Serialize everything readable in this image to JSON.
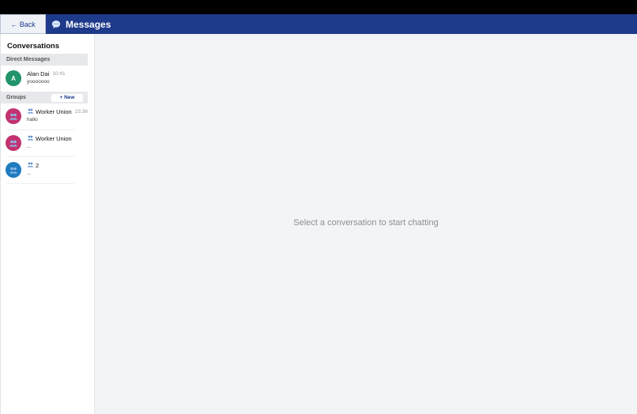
{
  "header": {
    "back_label": "← Back",
    "title": "Messages",
    "icon": "chat-bubble-icon",
    "bg_color": "#1e3a8a"
  },
  "sidebar": {
    "title": "Conversations",
    "direct_messages": {
      "heading": "Direct Messages",
      "items": [
        {
          "avatar_letter": "A",
          "avatar_color": "#22946b",
          "name": "Alan Dai",
          "time": "10:41",
          "preview": "yooooooo"
        }
      ]
    },
    "groups": {
      "heading": "Groups",
      "new_label": "+ New",
      "items": [
        {
          "avatar_color": "#c2336f",
          "name": "Worker Union",
          "time": "23:36",
          "preview": "hallo"
        },
        {
          "avatar_color": "#c2336f",
          "name": "Worker Union",
          "time": "",
          "preview": "..."
        },
        {
          "avatar_color": "#1f7bbf",
          "name": "2",
          "time": "",
          "preview": "..."
        }
      ]
    }
  },
  "main": {
    "empty_state": "Select a conversation to start chatting"
  }
}
